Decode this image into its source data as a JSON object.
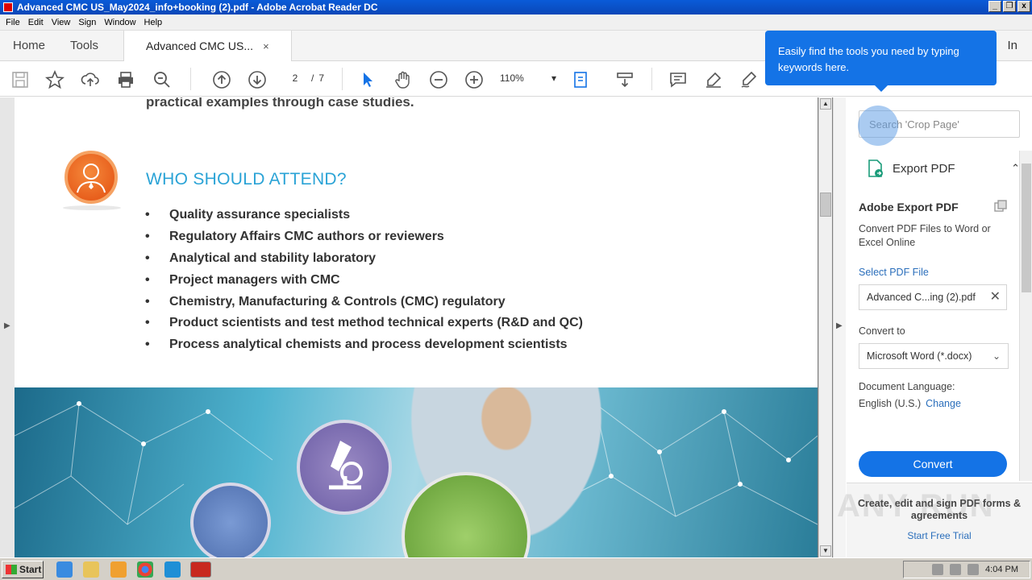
{
  "window": {
    "title": "Advanced CMC US_May2024_info+booking (2).pdf - Adobe Acrobat Reader DC",
    "controls": [
      "_",
      "❐",
      "x"
    ]
  },
  "menu": [
    "File",
    "Edit",
    "View",
    "Sign",
    "Window",
    "Help"
  ],
  "tabs": {
    "home": "Home",
    "tools": "Tools",
    "doc": "Advanced CMC US...",
    "close": "×"
  },
  "signin": "In",
  "toolbar": {
    "page_current": "2",
    "page_sep": "/",
    "page_total": "7",
    "zoom": "110%",
    "zoom_caret": "▾"
  },
  "tooltip": {
    "text": "Easily find the tools you need by typing keywords here."
  },
  "document": {
    "fragment": "practical examples through case studies.",
    "heading": "WHO SHOULD ATTEND?",
    "bullets": [
      "Quality assurance specialists",
      "Regulatory Affairs CMC authors or reviewers",
      "Analytical and stability laboratory",
      "Project managers with CMC",
      "Chemistry, Manufacturing & Controls (CMC) regulatory",
      "Product scientists and test method technical experts (R&D and QC)",
      "Process analytical chemists and process development scientists"
    ],
    "heading_color": "#2aa3d6"
  },
  "right_panel": {
    "search_placeholder": "Search 'Crop Page'",
    "export_label": "Export PDF",
    "export_chevron": "⌃",
    "title": "Adobe Export PDF",
    "description": "Convert PDF Files to Word or Excel Online",
    "select_label": "Select PDF File",
    "file_name": "Advanced C...ing (2).pdf",
    "file_clear": "✕",
    "convert_to_label": "Convert to",
    "convert_to_value": "Microsoft Word (*.docx)",
    "convert_to_chevron": "⌄",
    "language_label": "Document Language:",
    "language_value": "English (U.S.)",
    "language_change": "Change",
    "convert_button": "Convert",
    "promo_text": "Create, edit and sign PDF forms & agreements",
    "promo_link": "Start Free Trial",
    "accent": "#1473e6"
  },
  "watermark": "ANY RUN",
  "taskbar": {
    "start": "Start",
    "clock": "4:04 PM"
  }
}
